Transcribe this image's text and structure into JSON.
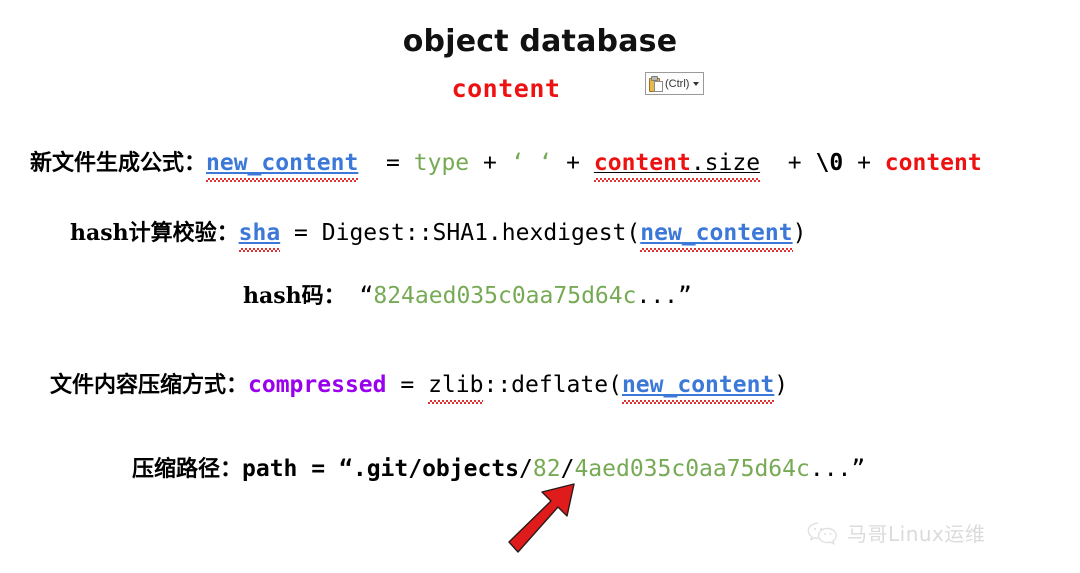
{
  "slide": {
    "title": "object database",
    "subtitle": "content"
  },
  "paste_options": {
    "label": "(Ctrl)",
    "icon": "clipboard-paste-icon",
    "caret": "chevron-down-icon"
  },
  "rows": {
    "new_content": {
      "label_cn": "新文件生成公式：",
      "var": "new_content",
      "eq": "=",
      "type": "type",
      "plus1": "+",
      "quote_open": "‘",
      "quote_close": "‘",
      "plus2": "+",
      "content": "content",
      "dot_size": ".size",
      "plus3": "+",
      "nul": "\\0",
      "plus4": "+",
      "content2": "content"
    },
    "hash": {
      "label_cn": "hash计算校验：",
      "sha": "sha",
      "eq": "=",
      "call": "Digest::SHA1.hexdigest(",
      "arg": "new_content",
      "close": ")"
    },
    "hashcode": {
      "label_cn": "hash码：",
      "quote_open": "“",
      "value": "824aed035c0aa75d64c",
      "ellipsis": "...",
      "quote_close": "”"
    },
    "compressed": {
      "label_cn": "文件内容压缩方式：",
      "var": "compressed",
      "eq": "=",
      "zlib": "zlib",
      "call": "::deflate(",
      "arg": "new_content",
      "close": ")"
    },
    "path": {
      "label_cn": "压缩路径：",
      "var": "path",
      "eq": "=",
      "quote_open": "“",
      "dir": ".git/objects",
      "slash1": "/",
      "prefix": "82",
      "slash2": "/",
      "rest": "4aed035c0aa75d64c",
      "ellipsis": "...",
      "quote_close": "”"
    }
  },
  "annotation": {
    "arrow": "red-arrow-pointing-to-path-prefix"
  },
  "watermark": {
    "icon": "wechat-icon",
    "text": "马哥Linux运维"
  },
  "colors": {
    "red": "#ee1111",
    "blue": "#3b78d8",
    "green": "#77aa55",
    "purple": "#9900ee",
    "black": "#000000",
    "spell_squiggle": "#e02020",
    "arrow": "#e01b1b"
  }
}
